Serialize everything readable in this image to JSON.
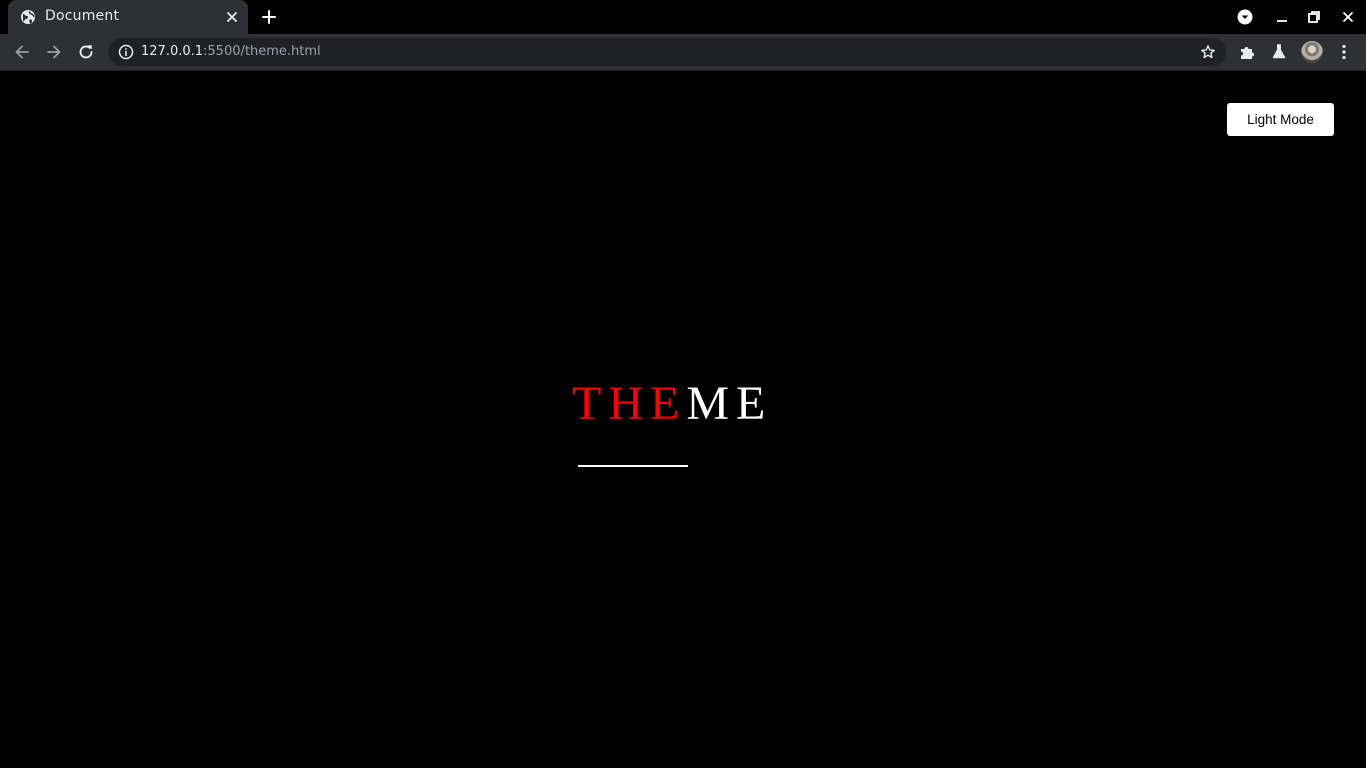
{
  "tab": {
    "title": "Document",
    "favicon": "globe-icon"
  },
  "toolbar": {
    "url_host": "127.0.0.1",
    "url_path": ":5500/theme.html"
  },
  "page": {
    "mode_button_label": "Light Mode",
    "headline_red": "THE",
    "headline_white": "ME"
  },
  "colors": {
    "background": "#000000",
    "accent": "#ff0000",
    "text": "#ffffff"
  }
}
